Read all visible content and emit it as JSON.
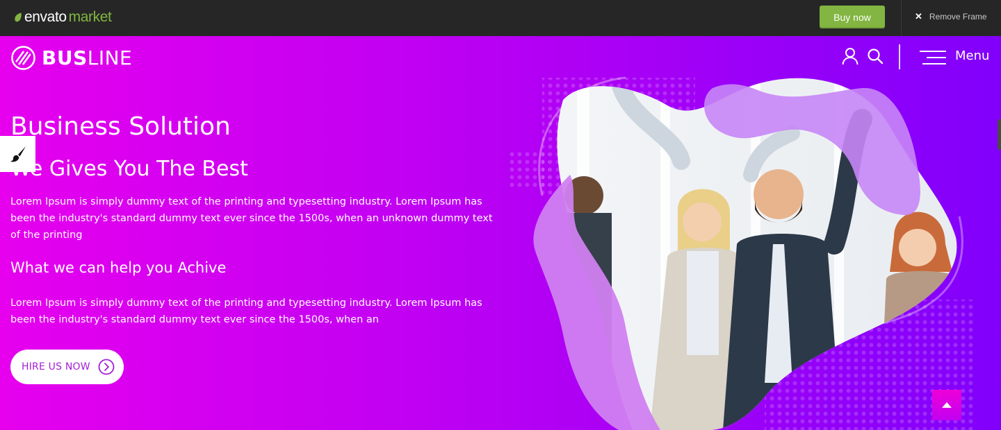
{
  "envato_bar": {
    "logo_word1": "envato",
    "logo_word2": "market",
    "buy_label": "Buy now",
    "remove_frame_label": "Remove Frame",
    "accent_color": "#82b541"
  },
  "header": {
    "brand_bold": "BUS",
    "brand_light": "LINE",
    "menu_label": "Menu"
  },
  "hero": {
    "title": "Business Solution",
    "subtitle": "We Gives You The Best",
    "paragraph1": "Lorem Ipsum is simply dummy text of the printing and typesetting industry. Lorem Ipsum has been the industry's standard dummy text ever since the 1500s, when an unknown dummy text of the printing",
    "section_heading": "What we can help you Achive",
    "paragraph2": "Lorem Ipsum is simply dummy text of the printing and typesetting industry. Lorem Ipsum has been the industry's standard dummy text ever since the 1500s, when an",
    "cta_label": "HIRE US NOW",
    "gradient_colors": [
      "#e600ee",
      "#8100fb"
    ]
  },
  "icons": {
    "user": "user-icon",
    "search": "search-icon",
    "menu": "hamburger-icon",
    "paint": "paintbrush-icon",
    "cta_arrow": "chevron-right-circle-icon",
    "scroll_top": "caret-up-icon"
  }
}
